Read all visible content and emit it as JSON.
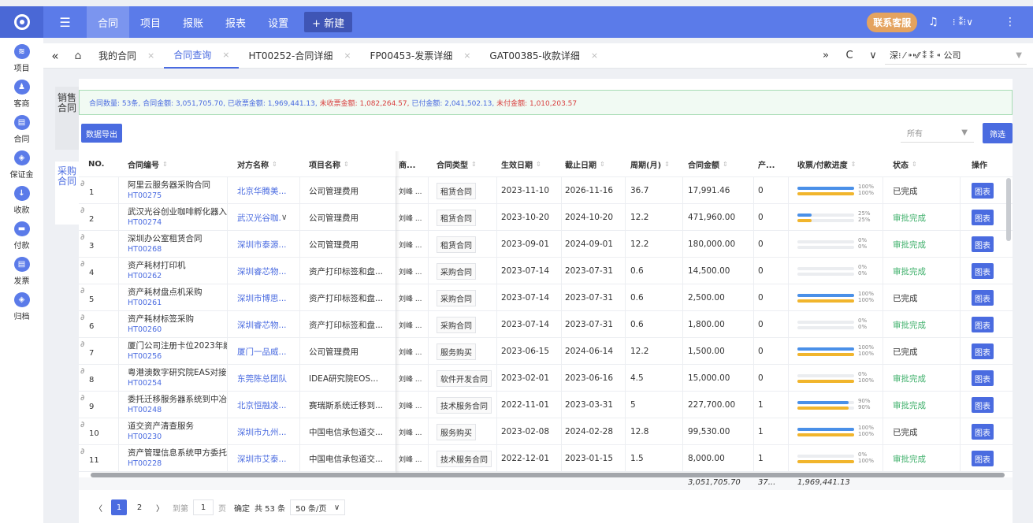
{
  "topbar": {
    "menu_toggle": "☰",
    "nav": [
      "合同",
      "项目",
      "报账",
      "报表",
      "设置"
    ],
    "new_label": "+ 新建",
    "service_label": "联系客服",
    "bell": "♫",
    "user_label": "⁝ ⁑⁝∨",
    "more": "⋮"
  },
  "rail": [
    {
      "label": "项目",
      "icon": "≋"
    },
    {
      "label": "客商",
      "icon": "♟"
    },
    {
      "label": "合同",
      "icon": "▤"
    },
    {
      "label": "保证金",
      "icon": "◈"
    },
    {
      "label": "收款",
      "icon": "↓"
    },
    {
      "label": "付款",
      "icon": "▬"
    },
    {
      "label": "发票",
      "icon": "▤"
    },
    {
      "label": "归档",
      "icon": "◈"
    }
  ],
  "tabs": {
    "collapse": "«",
    "home": "⌂",
    "items": [
      "我的合同",
      "合同查询",
      "HT00252-合同详细",
      "FP00453-发票详细",
      "GAT00385-收款详细"
    ],
    "forward": "»",
    "refresh": "C",
    "dropdown": "∨",
    "company": "深⁝ ⁄ ⁍⁍⁄⁄ ⁑ ⁑ ⁌ 公司"
  },
  "side_tabs": {
    "sales": "销售合同",
    "purchase": "采购合同"
  },
  "summary": {
    "count": "合同数量: 53条,",
    "amount": "合同金额: 3,051,705.70,",
    "received": "已收票金额: 1,969,441.13,",
    "unreceived": "未收票金额: 1,082,264.57,",
    "paid": "已付金额: 2,041,502.13,",
    "unpaid": "未付金额: 1,010,203.57"
  },
  "toolbar": {
    "export": "数据导出",
    "filter_value": "所有",
    "filter_btn": "筛选"
  },
  "table": {
    "headers": [
      "NO.",
      "合同编号",
      "对方名称",
      "项目名称",
      "商...",
      "合同类型",
      "生效日期",
      "截止日期",
      "周期(月)",
      "合同金额",
      "产...",
      "收票/付款进度",
      "状态",
      "操作"
    ],
    "op_label": "图表",
    "rows": [
      {
        "no": "1",
        "name": "阿里云服务器采购合同",
        "code": "HT00275",
        "party": "北京华腾美...",
        "project": "公司管理费用",
        "handler": "刘峰 ...",
        "type": "租赁合同",
        "start": "2023-11-10",
        "end": "2026-11-16",
        "period": "36.7",
        "amount": "17,991.46",
        "prod": "0",
        "p1": 100,
        "p2": 100,
        "p1_label": "100%",
        "p2_label": "100%",
        "status": "已完成",
        "done": true
      },
      {
        "no": "2",
        "name": "武汉光谷创业咖啡孵化器入",
        "code": "HT00274",
        "party": "武汉光谷咖.",
        "project": "公司管理费用",
        "handler": "刘峰 ...",
        "type": "租赁合同",
        "start": "2023-10-20",
        "end": "2024-10-20",
        "period": "12.2",
        "amount": "471,960.00",
        "prod": "0",
        "p1": 25,
        "p2": 25,
        "p1_label": "25%",
        "p2_label": "25%",
        "status": "审批完成",
        "done": false
      },
      {
        "no": "3",
        "name": "深圳办公室租赁合同",
        "code": "HT00268",
        "party": "深圳市泰源...",
        "project": "公司管理费用",
        "handler": "刘峰 ...",
        "type": "租赁合同",
        "start": "2023-09-01",
        "end": "2024-09-01",
        "period": "12.2",
        "amount": "180,000.00",
        "prod": "0",
        "p1": 0,
        "p2": 0,
        "p1_label": "0%",
        "p2_label": "0%",
        "status": "审批完成",
        "done": false
      },
      {
        "no": "4",
        "name": "资产耗材打印机",
        "code": "HT00262",
        "party": "深圳睿芯物...",
        "project": "资产打印标签和盘...",
        "handler": "刘峰 ...",
        "type": "采购合同",
        "start": "2023-07-14",
        "end": "2023-07-31",
        "period": "0.6",
        "amount": "14,500.00",
        "prod": "0",
        "p1": 0,
        "p2": 0,
        "p1_label": "0%",
        "p2_label": "0%",
        "status": "审批完成",
        "done": false
      },
      {
        "no": "5",
        "name": "资产耗材盘点机采购",
        "code": "HT00261",
        "party": "深圳市博思...",
        "project": "资产打印标签和盘...",
        "handler": "刘峰 ...",
        "type": "采购合同",
        "start": "2023-07-14",
        "end": "2023-07-31",
        "period": "0.6",
        "amount": "2,500.00",
        "prod": "0",
        "p1": 100,
        "p2": 100,
        "p1_label": "100%",
        "p2_label": "100%",
        "status": "已完成",
        "done": true
      },
      {
        "no": "6",
        "name": "资产耗材标签采购",
        "code": "HT00260",
        "party": "深圳睿芯物...",
        "project": "资产打印标签和盘...",
        "handler": "刘峰 ...",
        "type": "采购合同",
        "start": "2023-07-14",
        "end": "2023-07-31",
        "period": "0.6",
        "amount": "1,800.00",
        "prod": "0",
        "p1": 0,
        "p2": 0,
        "p1_label": "0%",
        "p2_label": "0%",
        "status": "审批完成",
        "done": false
      },
      {
        "no": "7",
        "name": "厦门公司注册卡位2023年續",
        "code": "HT00256",
        "party": "厦门一品威...",
        "project": "公司管理费用",
        "handler": "刘峰 ...",
        "type": "服务购买",
        "start": "2023-06-15",
        "end": "2024-06-14",
        "period": "12.2",
        "amount": "1,500.00",
        "prod": "0",
        "p1": 100,
        "p2": 100,
        "p1_label": "100%",
        "p2_label": "100%",
        "status": "已完成",
        "done": true
      },
      {
        "no": "8",
        "name": "粤港澳数字研究院EAS对接",
        "code": "HT00254",
        "party": "东莞陈总团队",
        "project": "IDEA研究院EOS...",
        "handler": "刘峰 ...",
        "type": "软件开发合同",
        "start": "2023-02-01",
        "end": "2023-06-16",
        "period": "4.5",
        "amount": "15,000.00",
        "prod": "0",
        "p1": 0,
        "p2": 100,
        "p1_label": "0%",
        "p2_label": "100%",
        "status": "审批完成",
        "done": false
      },
      {
        "no": "9",
        "name": "委托迁移服务器系统到中冶",
        "code": "HT00248",
        "party": "北京恒融凌...",
        "project": "赛瑞斯系统迁移到...",
        "handler": "刘峰 ...",
        "type": "技术服务合同",
        "start": "2022-11-01",
        "end": "2023-03-31",
        "period": "5",
        "amount": "227,700.00",
        "prod": "1",
        "p1": 90,
        "p2": 90,
        "p1_label": "90%",
        "p2_label": "90%",
        "status": "审批完成",
        "done": false
      },
      {
        "no": "10",
        "name": "道交资产清查服务",
        "code": "HT00230",
        "party": "深圳市九州...",
        "project": "中国电信承包道交...",
        "handler": "刘峰 ...",
        "type": "服务购买",
        "start": "2023-02-08",
        "end": "2024-02-28",
        "period": "12.8",
        "amount": "99,530.00",
        "prod": "1",
        "p1": 100,
        "p2": 100,
        "p1_label": "100%",
        "p2_label": "100%",
        "status": "已完成",
        "done": true
      },
      {
        "no": "11",
        "name": "资产管理信息系统甲方委托",
        "code": "HT00228",
        "party": "深圳市艾泰...",
        "project": "中国电信承包道交...",
        "handler": "刘峰 ...",
        "type": "技术服务合同",
        "start": "2022-12-01",
        "end": "2023-01-15",
        "period": "1.5",
        "amount": "8,000.00",
        "prod": "1",
        "p1": 0,
        "p2": 100,
        "p1_label": "0%",
        "p2_label": "100%",
        "status": "审批完成",
        "done": false
      }
    ],
    "totals": {
      "amount": "3,051,705.70",
      "prod": "37...",
      "progress": "1,969,441.13"
    }
  },
  "pager": {
    "prev": "〈",
    "page1": "1",
    "page2": "2",
    "next": "〉",
    "goto": "到第",
    "goto_value": "1",
    "page_unit": "页",
    "confirm": "确定",
    "total": "共 53 条",
    "size": "50 条/页",
    "size_caret": "∨"
  },
  "colors": {
    "primary": "#5b7be9",
    "button": "#4a6be0",
    "success": "#3fb06b",
    "danger": "#d94040",
    "bar_blue": "#4a90e8",
    "bar_yellow": "#f1b52c"
  }
}
